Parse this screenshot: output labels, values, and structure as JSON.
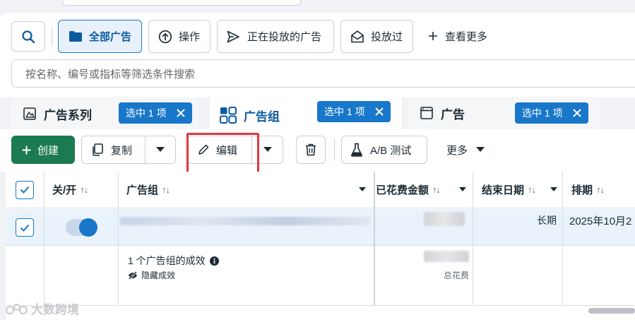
{
  "filter_bar": {
    "search_button_icon": "search-icon",
    "all_ads_label": "全部广告",
    "operations_label": "操作",
    "active_ads_label": "正在投放的广告",
    "delivered_label": "投放过",
    "view_more_label": "查看更多",
    "search_placeholder": "按名称、编号或指标等筛选条件搜索"
  },
  "level_tabs": [
    {
      "label": "广告系列",
      "icon": "campaign-icon",
      "badge": null
    },
    {
      "label": "广告组",
      "icon": "adset-grid-icon",
      "badge": "选中 1 项"
    },
    {
      "label": "广告",
      "icon": "ad-window-icon",
      "badge": "选中 1 项"
    }
  ],
  "toolbar": {
    "create_label": "创建",
    "copy_label": "复制",
    "edit_label": "编辑",
    "ab_test_label": "A/B 测试",
    "more_label": "更多"
  },
  "table": {
    "columns": {
      "toggle": "关/开",
      "adset": "广告组",
      "spent": "已花费金额",
      "end_date": "结束日期",
      "schedule": "排期"
    },
    "row": {
      "selected": true,
      "on": true,
      "end_date": "长期",
      "schedule": "2025年10月2"
    },
    "summary": {
      "results_text": "1 个广告组的成效",
      "hidden_results": "隐藏成效",
      "total_spent_label": "总花费"
    }
  },
  "watermark": "大数跨境",
  "colors": {
    "accent": "#1877c9",
    "create_green": "#1b7a4f",
    "highlight_red": "#e0383b",
    "selected_row": "#eaf3fc"
  }
}
